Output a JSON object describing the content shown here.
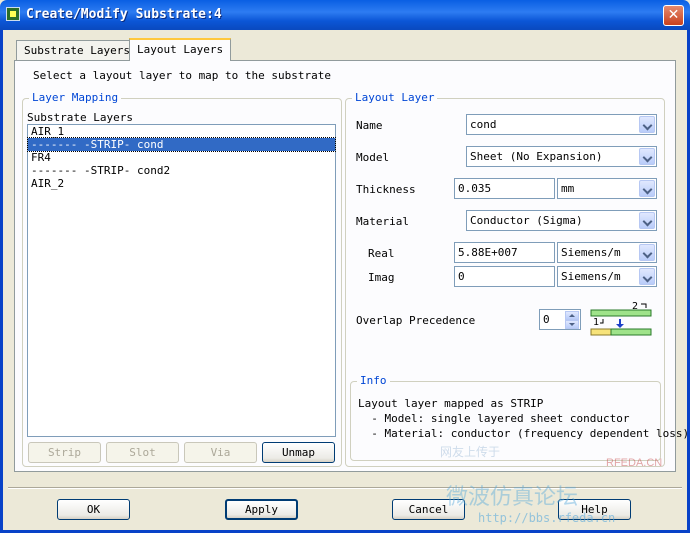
{
  "window": {
    "title": "Create/Modify Substrate:4",
    "close_label": "✕"
  },
  "tabs": [
    {
      "label": "Substrate Layers",
      "active": false
    },
    {
      "label": "Layout Layers",
      "active": true
    }
  ],
  "instruction": "Select a layout layer to map to the substrate",
  "layer_mapping": {
    "title": "Layer Mapping",
    "list_label": "Substrate Layers",
    "items": [
      {
        "text": "AIR_1",
        "selected": false
      },
      {
        "text": "------- -STRIP- cond",
        "selected": true
      },
      {
        "text": "FR4",
        "selected": false
      },
      {
        "text": "------- -STRIP- cond2",
        "selected": false
      },
      {
        "text": "AIR_2",
        "selected": false
      }
    ],
    "buttons": {
      "strip": "Strip",
      "slot": "Slot",
      "via": "Via",
      "unmap": "Unmap"
    }
  },
  "layout_layer": {
    "title": "Layout Layer",
    "name_label": "Name",
    "name_value": "cond",
    "model_label": "Model",
    "model_value": "Sheet (No Expansion)",
    "thickness_label": "Thickness",
    "thickness_value": "0.035",
    "thickness_unit": "mm",
    "material_label": "Material",
    "material_value": "Conductor (Sigma)",
    "real_label": "Real",
    "real_value": "5.88E+007",
    "real_unit": "Siemens/m",
    "imag_label": "Imag",
    "imag_value": "0",
    "imag_unit": "Siemens/m",
    "overlap_label": "Overlap Precedence",
    "overlap_value": "0",
    "diagram_label_1": "1",
    "diagram_label_2": "2"
  },
  "info": {
    "title": "Info",
    "lines": [
      "Layout layer mapped as STRIP",
      "  - Model: single layered sheet conductor",
      "  - Material: conductor (frequency dependent loss)"
    ]
  },
  "footer": {
    "ok": "OK",
    "apply": "Apply",
    "cancel": "Cancel",
    "help": "Help"
  },
  "watermark": {
    "line1": "网友上传于",
    "site": "RFEDA.CN",
    "chinese": "微波仿真论坛",
    "url": "http://bbs.rfeda.cn"
  },
  "colors": {
    "title_bar": "#0A5FE3",
    "group_title": "#0046D5",
    "selection": "#316AC5",
    "diagram_green": "#9FE38A",
    "diagram_yellow": "#F7E37A",
    "diagram_arrow": "#1B3FC8"
  }
}
